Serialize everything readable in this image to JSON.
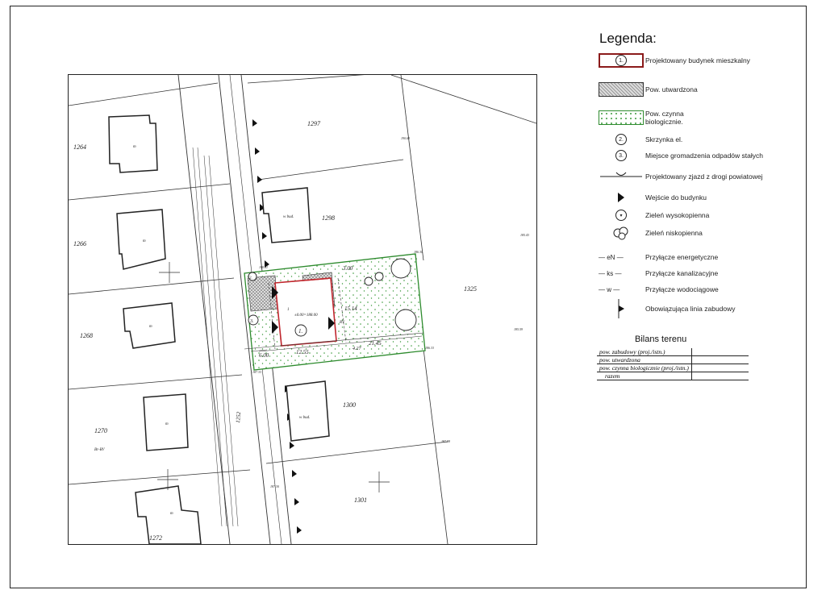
{
  "legend": {
    "title": "Legenda:",
    "items": [
      {
        "symbol": "building",
        "symbol_text": "1.",
        "label": "Projektowany budynek mieszkalny"
      },
      {
        "symbol": "hatched-area",
        "label": "Pow. utwardzona"
      },
      {
        "symbol": "green-dotted-area",
        "label": "Pow. czynna biologicznie."
      },
      {
        "symbol": "circle-number",
        "symbol_text": "2.",
        "label": "Skrzynka el."
      },
      {
        "symbol": "circle-number",
        "symbol_text": "3.",
        "label": "Miejsce gromadzenia odpadów stałych"
      },
      {
        "symbol": "driveway-icon",
        "label": "Projektowany zjazd z drogi powiatowej"
      },
      {
        "symbol": "entrance-triangle-icon",
        "label": "Wejście do budynku"
      },
      {
        "symbol": "tall-greenery-icon",
        "label": "Zieleń wysokopienna"
      },
      {
        "symbol": "low-greenery-icon",
        "label": "Zieleń niskopienna"
      },
      {
        "symbol": "line-code",
        "symbol_text": "eN",
        "label": "Przyłącze energetyczne"
      },
      {
        "symbol": "line-code",
        "symbol_text": "ks",
        "label": "Przyłącze kanalizacyjne"
      },
      {
        "symbol": "line-code",
        "symbol_text": "w",
        "label": "Przyłącze wodociągowe"
      },
      {
        "symbol": "building-line-icon",
        "label": "Obowiązująca linia zabudowy"
      }
    ]
  },
  "bilans": {
    "title": "Bilans terenu",
    "rows": [
      "pow. zabudowy (proj./istn.)",
      "pow. utwardzona",
      "pow. czynna biologicznie (proj./istn.)",
      "razem"
    ]
  },
  "plan": {
    "parcels": [
      "1264",
      "1266",
      "1268",
      "1270",
      "1272",
      "1297",
      "1298",
      "1300",
      "1301",
      "1325",
      "1252"
    ],
    "building_label": "1.",
    "entrance_elev": "±0.00=188.00",
    "dimensions": [
      "3.00",
      "15.14",
      "12.55",
      "6.00",
      "21.45",
      "4.27"
    ],
    "house_labels": [
      "m",
      "m",
      "m",
      "m",
      "w bud.",
      "w bud.",
      "m"
    ],
    "land_class": "RV",
    "other_text": [
      "Br-RV",
      "1",
      "1",
      "2.",
      "3."
    ],
    "elevations": [
      "190.69",
      "185.43",
      "186.30",
      "185.59",
      "186.33",
      "187.33",
      "187.98",
      "187.30",
      "188.01",
      "187.56",
      "187.86",
      "187.79",
      "187.87",
      "186.87",
      "186.59"
    ]
  }
}
